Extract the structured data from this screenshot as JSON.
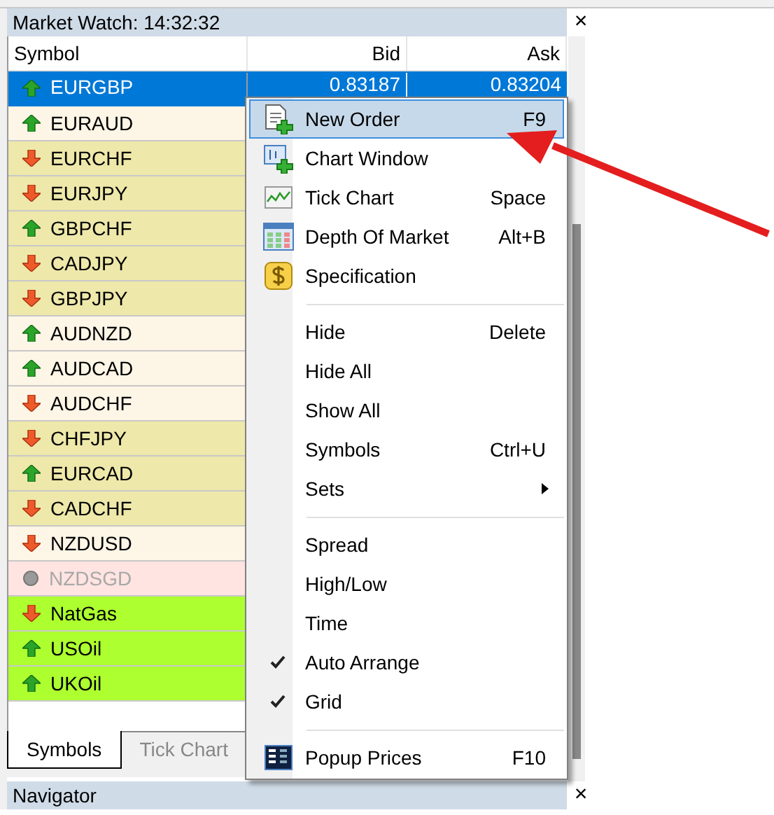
{
  "window": {
    "title": "Market Watch: 14:32:32",
    "close": "×"
  },
  "table": {
    "columns": [
      "Symbol",
      "Bid",
      "Ask"
    ],
    "rows": [
      {
        "symbol": "EURGBP",
        "kind": "up",
        "selected": true,
        "disabled": false,
        "bid": "0.83187",
        "ask": "0.83204"
      },
      {
        "symbol": "EURAUD",
        "kind": "up",
        "selected": false,
        "disabled": false,
        "color": "#fdf5e6"
      },
      {
        "symbol": "EURCHF",
        "kind": "down",
        "selected": false,
        "disabled": false,
        "color": "#eee8aa"
      },
      {
        "symbol": "EURJPY",
        "kind": "down",
        "selected": false,
        "disabled": false,
        "color": "#eee8aa"
      },
      {
        "symbol": "GBPCHF",
        "kind": "up",
        "selected": false,
        "disabled": false,
        "color": "#eee8aa"
      },
      {
        "symbol": "CADJPY",
        "kind": "down",
        "selected": false,
        "disabled": false,
        "color": "#eee8aa"
      },
      {
        "symbol": "GBPJPY",
        "kind": "down",
        "selected": false,
        "disabled": false,
        "color": "#eee8aa"
      },
      {
        "symbol": "AUDNZD",
        "kind": "up",
        "selected": false,
        "disabled": false,
        "color": "#fdf5e6"
      },
      {
        "symbol": "AUDCAD",
        "kind": "up",
        "selected": false,
        "disabled": false,
        "color": "#fdf5e6"
      },
      {
        "symbol": "AUDCHF",
        "kind": "down",
        "selected": false,
        "disabled": false,
        "color": "#fdf5e6"
      },
      {
        "symbol": "CHFJPY",
        "kind": "down",
        "selected": false,
        "disabled": false,
        "color": "#eee8aa"
      },
      {
        "symbol": "EURCAD",
        "kind": "up",
        "selected": false,
        "disabled": false,
        "color": "#eee8aa"
      },
      {
        "symbol": "CADCHF",
        "kind": "down",
        "selected": false,
        "disabled": false,
        "color": "#eee8aa"
      },
      {
        "symbol": "NZDUSD",
        "kind": "down",
        "selected": false,
        "disabled": false,
        "color": "#fdf5e6"
      },
      {
        "symbol": "NZDSGD",
        "kind": "none",
        "selected": false,
        "disabled": true,
        "color": "#ffe4e1"
      },
      {
        "symbol": "NatGas",
        "kind": "down",
        "selected": false,
        "disabled": false,
        "color": "#adff2f"
      },
      {
        "symbol": "USOil",
        "kind": "up",
        "selected": false,
        "disabled": false,
        "color": "#adff2f"
      },
      {
        "symbol": "UKOil",
        "kind": "up",
        "selected": false,
        "disabled": false,
        "color": "#adff2f"
      }
    ]
  },
  "tabs": [
    {
      "label": "Symbols",
      "selected": true
    },
    {
      "label": "Tick Chart",
      "selected": false
    }
  ],
  "navigator": {
    "title": "Navigator",
    "close": "×"
  },
  "context_menu": {
    "items": [
      {
        "kind": "order",
        "label": "New Order",
        "shortcut": "F9",
        "selected": true,
        "checked": false
      },
      {
        "kind": "chart",
        "label": "Chart Window",
        "selected": false,
        "checked": false
      },
      {
        "kind": "tick",
        "label": "Tick Chart",
        "shortcut": "Space",
        "selected": false,
        "checked": false
      },
      {
        "kind": "depth",
        "label": "Depth Of Market",
        "shortcut": "Alt+B",
        "selected": false,
        "checked": false
      },
      {
        "kind": "spec",
        "label": "Specification",
        "selected": false,
        "checked": false
      },
      {
        "kind": "separator"
      },
      {
        "kind": "item",
        "label": "Hide",
        "shortcut": "Delete",
        "selected": false,
        "checked": false
      },
      {
        "kind": "item",
        "label": "Hide All",
        "selected": false,
        "checked": false
      },
      {
        "kind": "item",
        "label": "Show All",
        "selected": false,
        "checked": false
      },
      {
        "kind": "item",
        "label": "Symbols",
        "shortcut": "Ctrl+U",
        "selected": false,
        "checked": false
      },
      {
        "kind": "item",
        "label": "Sets",
        "submenu": true,
        "selected": false,
        "checked": false
      },
      {
        "kind": "separator"
      },
      {
        "kind": "item",
        "label": "Spread",
        "selected": false,
        "checked": false
      },
      {
        "kind": "item",
        "label": "High/Low",
        "selected": false,
        "checked": false
      },
      {
        "kind": "item",
        "label": "Time",
        "selected": false,
        "checked": false
      },
      {
        "kind": "item",
        "label": "Auto Arrange",
        "selected": false,
        "checked": true
      },
      {
        "kind": "item",
        "label": "Grid",
        "selected": false,
        "checked": true
      },
      {
        "kind": "separator"
      },
      {
        "kind": "popup",
        "label": "Popup Prices",
        "shortcut": "F10",
        "selected": false,
        "checked": false
      }
    ]
  }
}
